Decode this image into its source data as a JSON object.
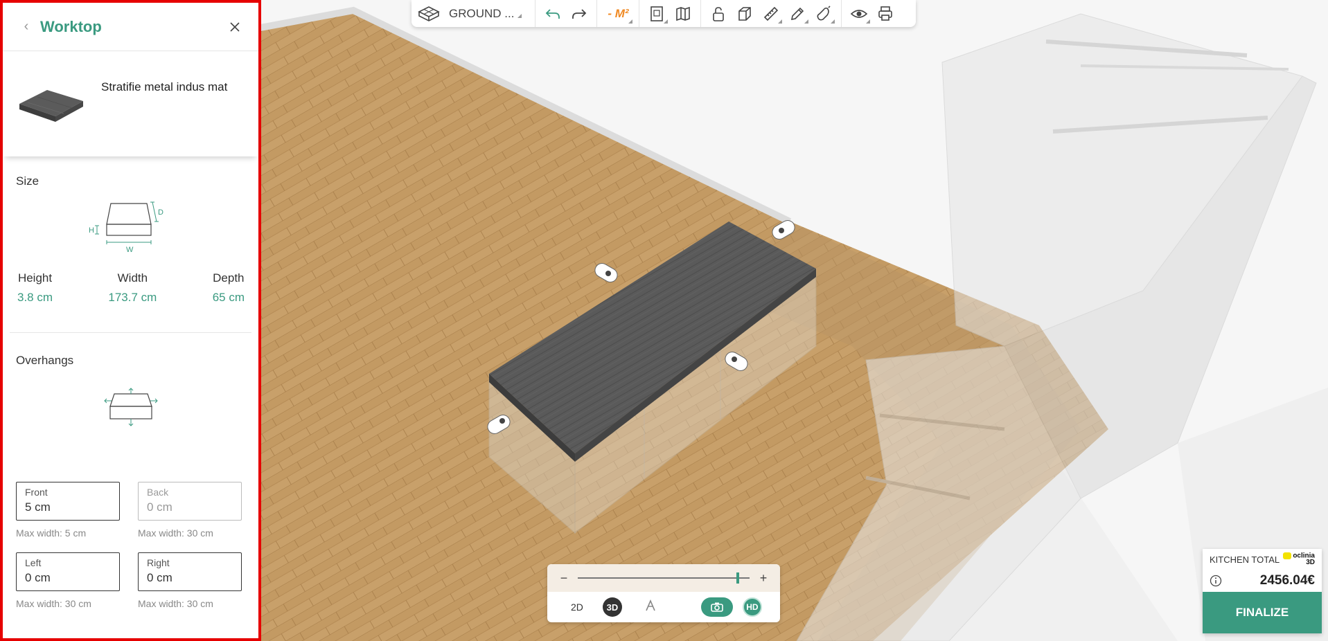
{
  "panel": {
    "title": "Worktop",
    "product_name": "Stratifie metal indus mat",
    "size_title": "Size",
    "size_diagram": {
      "h": "H",
      "w": "W",
      "d": "D"
    },
    "dimensions": [
      {
        "label": "Height",
        "value": "3.8 cm"
      },
      {
        "label": "Width",
        "value": "173.7 cm"
      },
      {
        "label": "Depth",
        "value": "65 cm"
      }
    ],
    "overhangs_title": "Overhangs",
    "fields": {
      "front": {
        "label": "Front",
        "value": "5 cm",
        "hint": "Max width: 5 cm"
      },
      "back": {
        "label": "Back",
        "value": "0 cm",
        "hint": "Max width: 30 cm"
      },
      "left": {
        "label": "Left",
        "value": "0 cm",
        "hint": "Max width: 30 cm"
      },
      "right": {
        "label": "Right",
        "value": "0 cm",
        "hint": "Max width: 30 cm"
      }
    }
  },
  "toolbar": {
    "floor_label": "GROUND ...",
    "unit_label": "- M²",
    "icons": [
      "floor-plan-icon",
      "undo-icon",
      "redo-icon",
      "document-icon",
      "map-icon",
      "lock-open-icon",
      "cube-icon",
      "ruler-icon",
      "pencil-icon",
      "magnet-icon",
      "eye-icon",
      "printer-icon"
    ]
  },
  "view": {
    "zoom_minus": "−",
    "zoom_plus": "+",
    "zoom_level": 0.93,
    "mode_2d": "2D",
    "mode_3d": "3D",
    "hd": "HD"
  },
  "total": {
    "label": "KITCHEN TOTAL",
    "brand_line1": "oclinia",
    "brand_line2": "3D",
    "price": "2456.04€",
    "finalize": "FINALIZE"
  },
  "colors": {
    "accent": "#3a9a80",
    "highlight_border": "#e60000",
    "unit_orange": "#f08a24",
    "floor_wood": "#c49a62",
    "worktop": "#555555"
  }
}
